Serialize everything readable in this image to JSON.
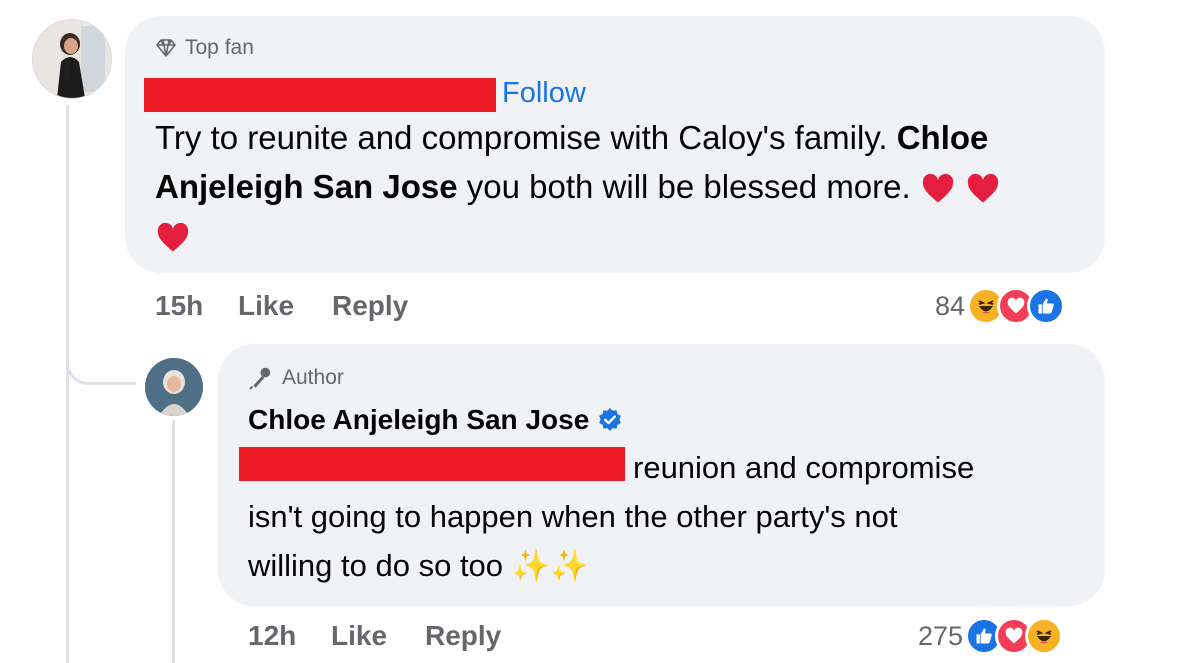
{
  "comment": {
    "badge": "Top fan",
    "follow": "Follow",
    "text_part1": "Try to reunite and compromise with Caloy's family.",
    "mention_line1": "Chloe",
    "mention_line2": "Anjeleigh San Jose",
    "text_part2": "you both will be blessed more.",
    "time": "15h",
    "like": "Like",
    "reply": "Reply",
    "reaction_count": "84",
    "reactions": [
      "haha",
      "love",
      "like"
    ]
  },
  "reply": {
    "badge": "Author",
    "author_name": "Chloe Anjeleigh San Jose",
    "text_line1": "reunion and compromise",
    "text_line2": "isn't going to happen when the other party's not",
    "text_line3": "willing to do so too",
    "sparkles": "✨✨",
    "time": "12h",
    "like": "Like",
    "reply": "Reply",
    "reaction_count": "275",
    "reactions": [
      "like",
      "love",
      "haha"
    ]
  },
  "colors": {
    "bubble": "#f0f2f5",
    "link_blue": "#1b74e4",
    "meta_gray": "#65676b",
    "redaction": "#ed1c24",
    "heart_red": "#e41e3f"
  }
}
